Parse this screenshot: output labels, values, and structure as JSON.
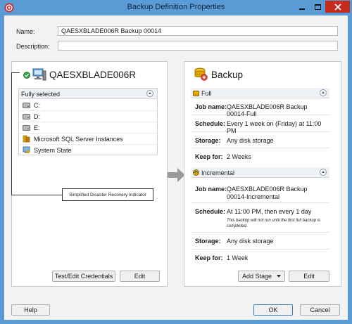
{
  "window": {
    "title": "Backup Definition Properties",
    "controls": [
      "minimize",
      "maximize",
      "close"
    ]
  },
  "form": {
    "name_label": "Name:",
    "name_value": "QAESXBLADE006R Backup 00014",
    "description_label": "Description:",
    "description_value": ""
  },
  "selections": {
    "server_name": "QAESXBLADE006R",
    "header": "Fully selected",
    "items": [
      {
        "label": "C:",
        "icon": "drive-icon"
      },
      {
        "label": "D:",
        "icon": "drive-icon"
      },
      {
        "label": "E:",
        "icon": "drive-icon"
      },
      {
        "label": "Microsoft SQL Server Instances",
        "icon": "sql-server-icon"
      },
      {
        "label": "System State",
        "icon": "system-state-icon"
      }
    ],
    "callout": "Simplified Disaster Recovery Indicator",
    "buttons": {
      "credentials": "Test/Edit Credentials",
      "edit": "Edit"
    }
  },
  "backup": {
    "title": "Backup",
    "full": {
      "header": "Full",
      "job_name_label": "Job name:",
      "job_name": "QAESXBLADE006R Backup 00014-Full",
      "schedule_label": "Schedule:",
      "schedule": "Every 1 week on (Friday) at 11:00 PM",
      "storage_label": "Storage:",
      "storage": "Any disk storage",
      "keep_label": "Keep for:",
      "keep": "2 Weeks"
    },
    "incremental": {
      "header": "Incremental",
      "job_name_label": "Job name:",
      "job_name": "QAESXBLADE006R Backup 00014-Incremental",
      "schedule_label": "Schedule:",
      "schedule": "At 11:00 PM, then every 1 day",
      "schedule_note": "This backup will not run until the first full backup is completed.",
      "storage_label": "Storage:",
      "storage": "Any disk storage",
      "keep_label": "Keep for:",
      "keep": "1 Week"
    },
    "buttons": {
      "add_stage": "Add Stage",
      "edit": "Edit"
    }
  },
  "footer": {
    "help": "Help",
    "ok": "OK",
    "cancel": "Cancel"
  },
  "colors": {
    "titlebar": "#5b9bd5",
    "close_button": "#c42b1c",
    "accent": "#e8a000",
    "sdr_green": "#2ea043"
  }
}
